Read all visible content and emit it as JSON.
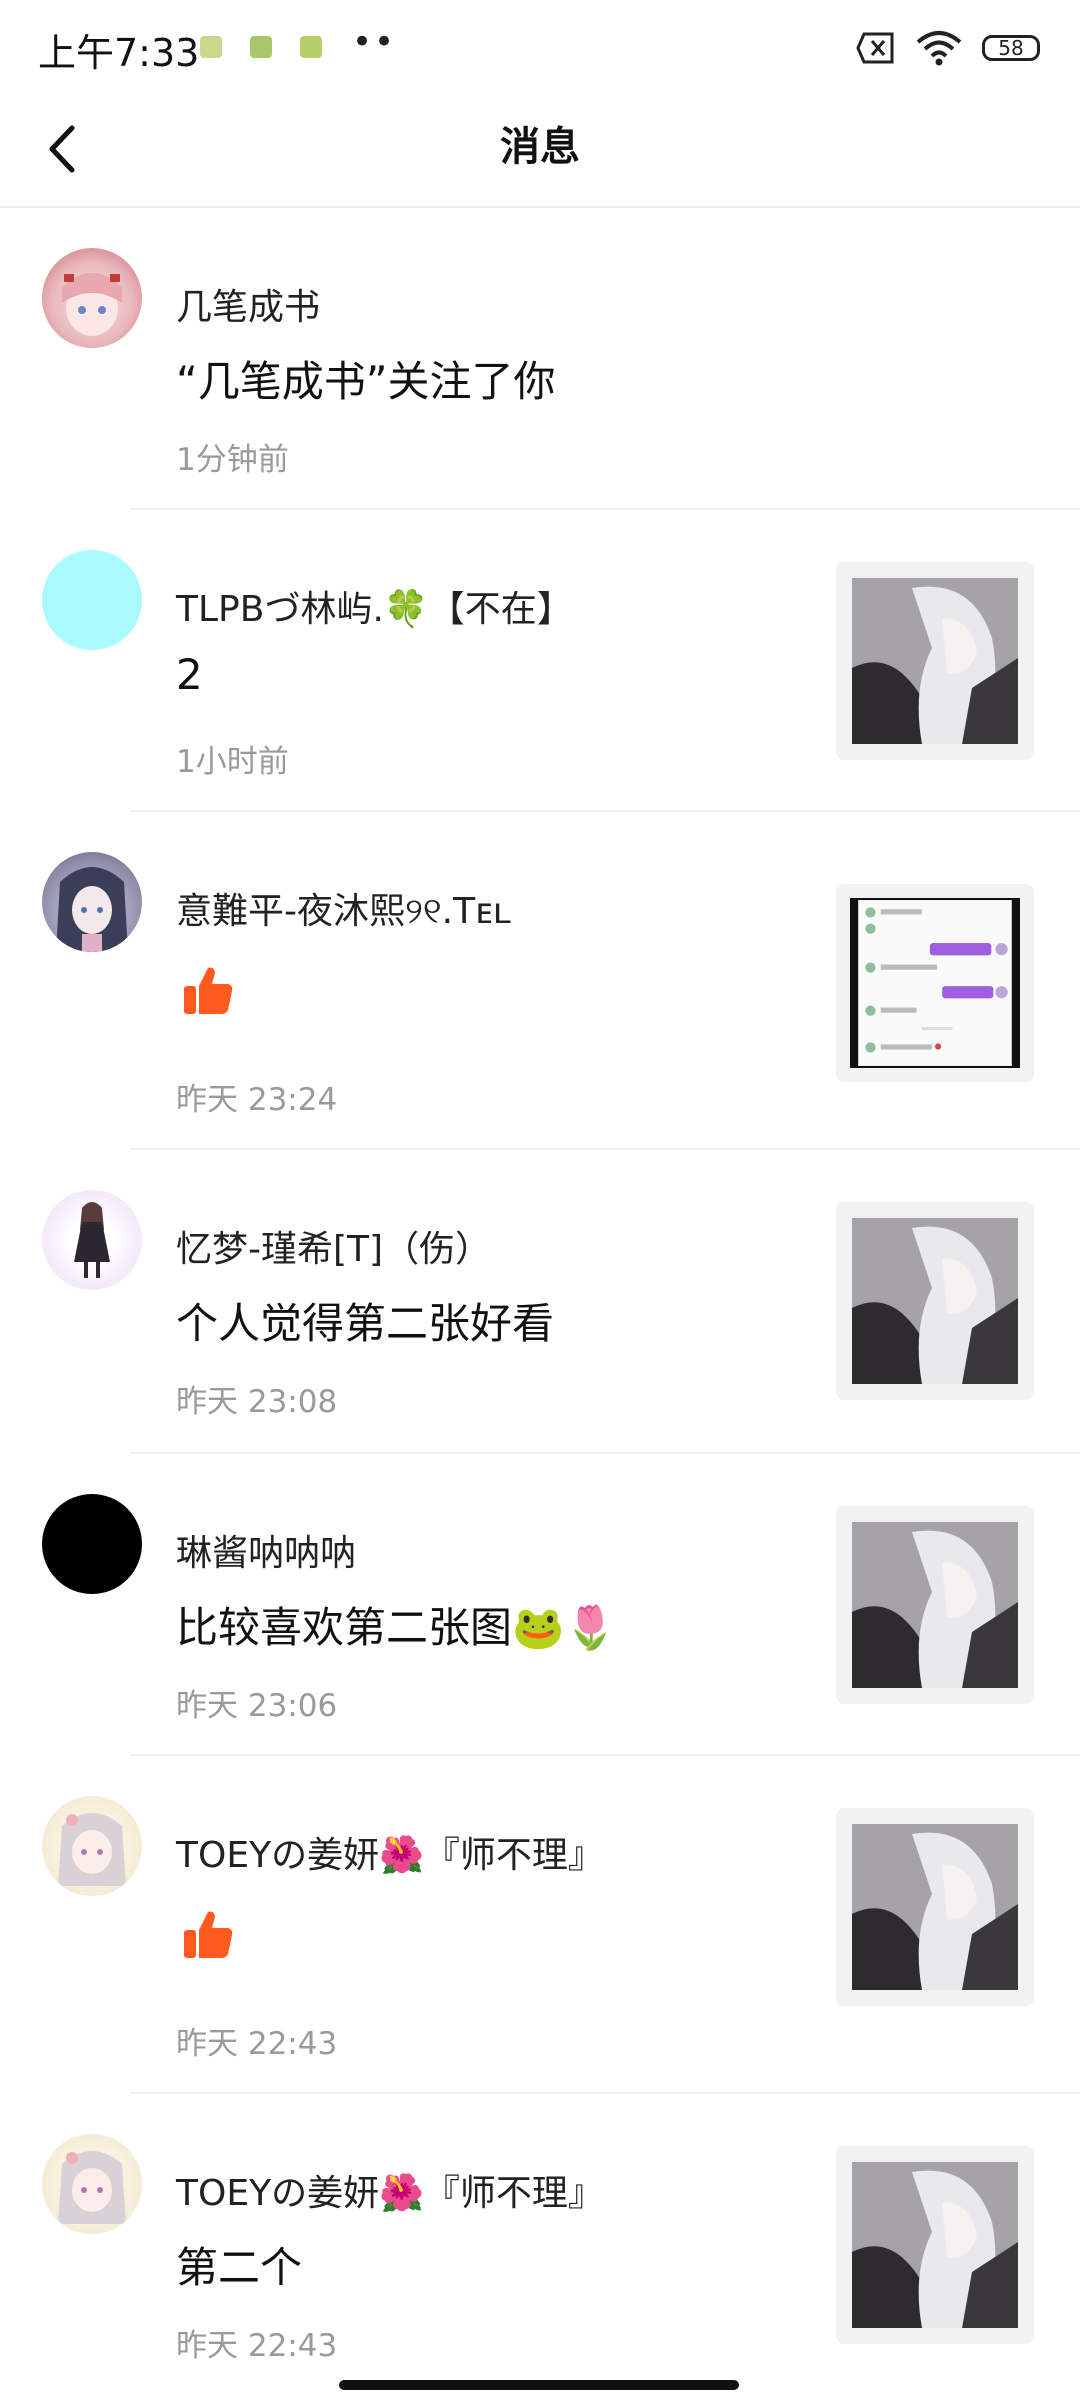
{
  "status_bar": {
    "time": "上午7:33",
    "dots": "••",
    "battery": "58"
  },
  "header": {
    "title": "消息"
  },
  "messages": [
    {
      "name": "几笔成书",
      "content": "“几笔成书”关注了你",
      "time": "1分钟前"
    },
    {
      "name": "TLPBづ林屿.🍀【不在】",
      "content": "2",
      "time": "1小时前"
    },
    {
      "name": "意難平-夜沐熙୨୧.Tᴇʟ",
      "content": "",
      "time": "昨天 23:24",
      "type": "like"
    },
    {
      "name": "忆梦-瑾希[T]（伤）",
      "content": "个人觉得第二张好看",
      "time": "昨天 23:08"
    },
    {
      "name": "琳酱呐呐呐",
      "content": "比较喜欢第二张图🐸🌷",
      "time": "昨天 23:06"
    },
    {
      "name": "TOEYの姜妍🌺『师不理』",
      "content": "",
      "time": "昨天 22:43",
      "type": "like"
    },
    {
      "name": "TOEYの姜妍🌺『师不理』",
      "content": "第二个",
      "time": "昨天 22:43"
    }
  ],
  "colors": {
    "like": "#ff5a1f",
    "time_text": "#9a9a9a",
    "divider": "#efefef"
  }
}
